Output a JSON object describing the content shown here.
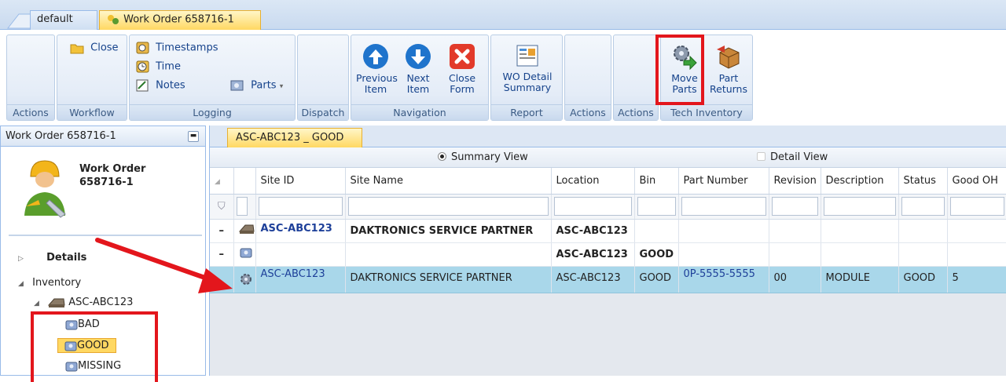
{
  "tabs": [
    {
      "label": "default"
    },
    {
      "label": "Work Order 658716-1"
    }
  ],
  "ribbon": {
    "groups": {
      "actions1": "Actions",
      "workflow": "Workflow",
      "logging": "Logging",
      "dispatch": "Dispatch",
      "navigation": "Navigation",
      "report": "Report",
      "actions2": "Actions",
      "actions3": "Actions",
      "tech_inventory": "Tech Inventory"
    },
    "close": "Close",
    "timestamps": "Timestamps",
    "time": "Time",
    "notes": "Notes",
    "parts": "Parts",
    "prev_item": [
      "Previous",
      "Item"
    ],
    "next_item": [
      "Next",
      "Item"
    ],
    "close_form": [
      "Close",
      "Form"
    ],
    "wo_detail": [
      "WO Detail",
      "Summary"
    ],
    "move_parts": [
      "Move",
      "Parts"
    ],
    "part_returns": [
      "Part",
      "Returns"
    ]
  },
  "left": {
    "header": "Work Order 658716-1",
    "wo_title": [
      "Work Order",
      "658716-1"
    ],
    "details": "Details",
    "inventory": "Inventory",
    "site": "ASC-ABC123",
    "bins": [
      "BAD",
      "GOOD",
      "MISSING"
    ]
  },
  "main": {
    "tab": "ASC-ABC123 _ GOOD",
    "summary_view": "Summary View",
    "detail_view": "Detail View",
    "columns": [
      "Site ID",
      "Site Name",
      "Location",
      "Bin",
      "Part Number",
      "Revision",
      "Description",
      "Status",
      "Good OH"
    ],
    "group1": {
      "site_id": "ASC-ABC123",
      "site_name": "DAKTRONICS SERVICE PARTNER",
      "location": "ASC-ABC123"
    },
    "group2": {
      "location": "ASC-ABC123",
      "bin": "GOOD"
    },
    "row": {
      "site_id": "ASC-ABC123",
      "site_name": "DAKTRONICS SERVICE PARTNER",
      "location": "ASC-ABC123",
      "bin": "GOOD",
      "part_number": "0P-5555-5555",
      "revision": "00",
      "description": "MODULE",
      "status": "GOOD",
      "good_oh": "5"
    }
  },
  "colors": {
    "highlight": "#e3161c",
    "selected_row": "#a9d7ea",
    "active_tab": "#ffd862"
  }
}
